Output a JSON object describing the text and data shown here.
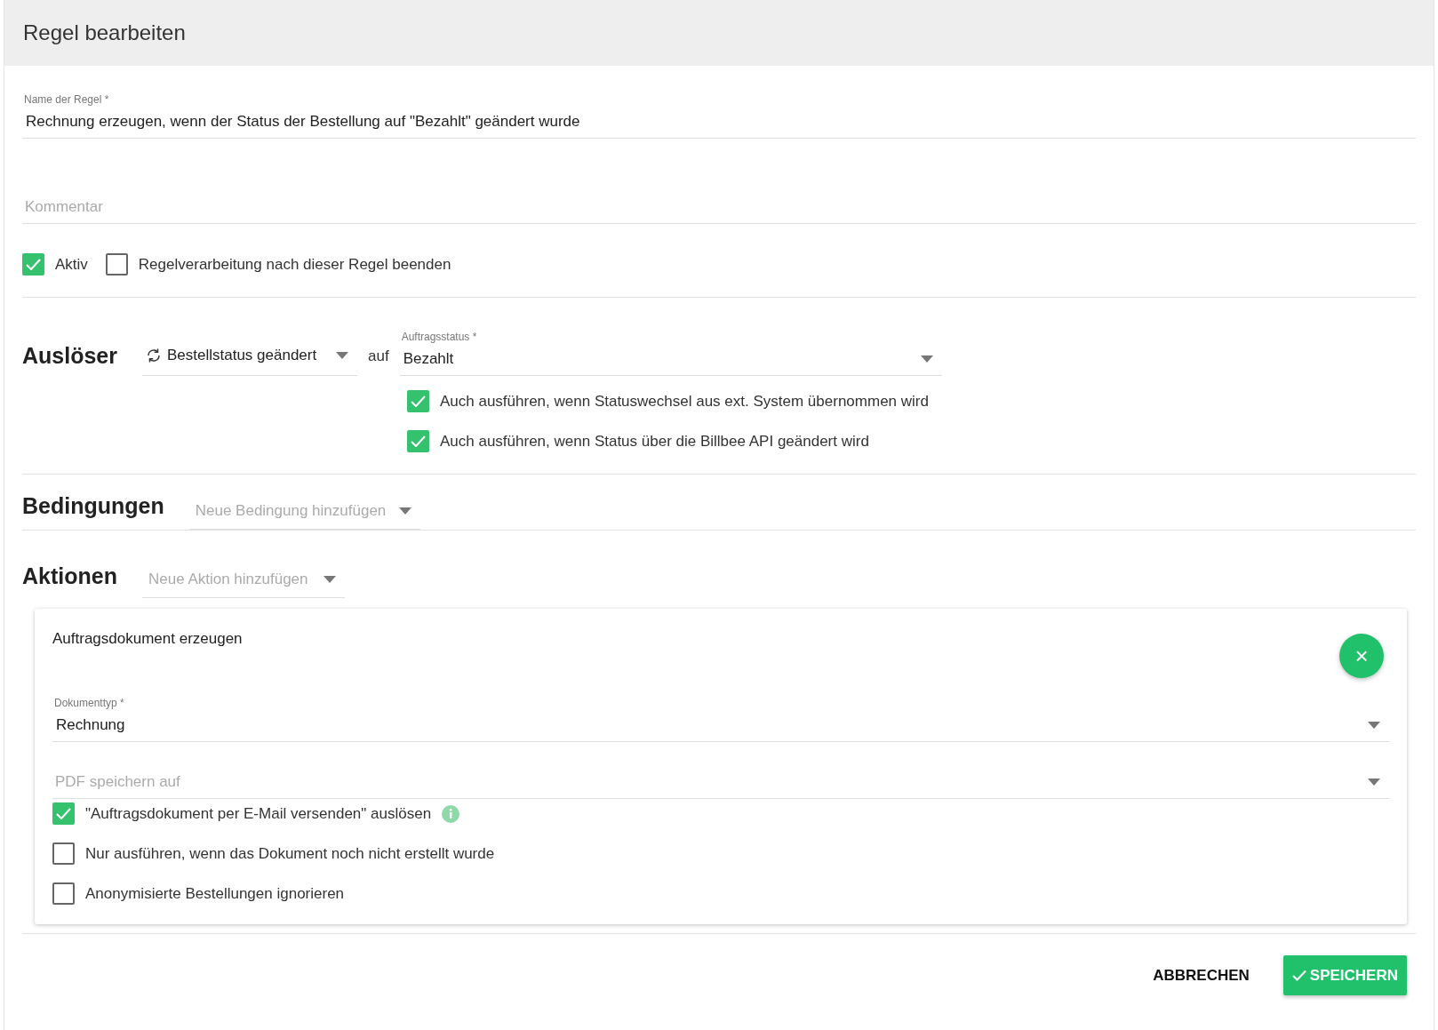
{
  "dialog": {
    "title": "Regel bearbeiten"
  },
  "name_field": {
    "label": "Name der Regel *",
    "value": "Rechnung erzeugen, wenn der Status der Bestellung auf \"Bezahlt\" geändert wurde"
  },
  "comment_field": {
    "placeholder": "Kommentar"
  },
  "options": [
    {
      "label": "Aktiv",
      "checked": true
    },
    {
      "label": "Regelverarbeitung nach dieser Regel beenden",
      "checked": false
    }
  ],
  "trigger": {
    "heading": "Auslöser",
    "event": "Bestellstatus geändert",
    "connector": "auf",
    "status_label": "Auftragsstatus *",
    "status_value": "Bezahlt",
    "options": [
      {
        "label": "Auch ausführen, wenn Statuswechsel aus ext. System übernommen wird",
        "checked": true
      },
      {
        "label": "Auch ausführen, wenn Status über die Billbee API geändert wird",
        "checked": true
      }
    ]
  },
  "conditions": {
    "heading": "Bedingungen",
    "placeholder": "Neue Bedingung hinzufügen"
  },
  "actions": {
    "heading": "Aktionen",
    "placeholder": "Neue Aktion hinzufügen",
    "cards": [
      {
        "title": "Auftragsdokument erzeugen",
        "close": "×",
        "doc_type_label": "Dokumenttyp *",
        "doc_type_value": "Rechnung",
        "pdf_placeholder": "PDF speichern auf",
        "options": [
          {
            "label": "\"Auftragsdokument per E-Mail versenden\" auslösen",
            "checked": true,
            "info": true
          },
          {
            "label": "Nur ausführen, wenn das Dokument noch nicht erstellt wurde",
            "checked": false,
            "info": false
          },
          {
            "label": "Anonymisierte Bestellungen ignorieren",
            "checked": false,
            "info": false
          }
        ]
      }
    ]
  },
  "buttons": [
    {
      "label": "ABBRECHEN",
      "kind": "text"
    },
    {
      "label": "SPEICHERN",
      "kind": "primary"
    }
  ]
}
